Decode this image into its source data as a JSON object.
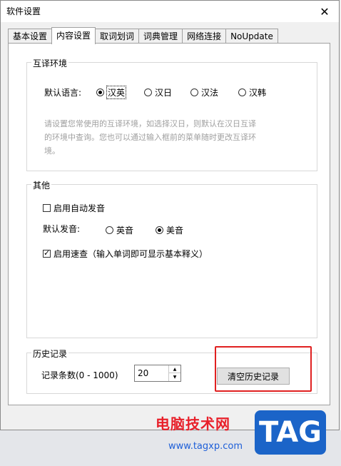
{
  "window": {
    "title": "软件设置",
    "close": "✕"
  },
  "tabs": [
    "基本设置",
    "内容设置",
    "取词划词",
    "词典管理",
    "网络连接",
    "NoUpdate"
  ],
  "env": {
    "legend": "互译环境",
    "label": "默认语言:",
    "options": [
      "汉英",
      "汉日",
      "汉法",
      "汉韩"
    ],
    "selected": "汉英",
    "hint_lines": [
      "请设置您常使用的互译环境，如选择汉日，则默认在汉日互译",
      "的环境中查询。您也可以通过输入框前的菜单随时更改互译环",
      "境。"
    ]
  },
  "other": {
    "legend": "其他",
    "auto_speak": {
      "label": "启用自动发音",
      "checked": false
    },
    "speak_label": "默认发音:",
    "speak_options": [
      "英音",
      "美音"
    ],
    "speak_selected": "美音",
    "quick_lookup": {
      "label": "启用速查（输入单词即可显示基本释义）",
      "checked": true
    }
  },
  "history": {
    "legend": "历史记录",
    "count_label": "记录条数(0 - 1000)",
    "count_value": "20",
    "clear_button": "清空历史记录"
  },
  "watermark": {
    "site_name": "电脑技术网",
    "url": "www.tagxp.com",
    "logo": "TAG"
  },
  "colors": {
    "highlight_box": "#e02020",
    "watermark_red": "#e8202a",
    "logo_blue": "#1b64c8"
  }
}
